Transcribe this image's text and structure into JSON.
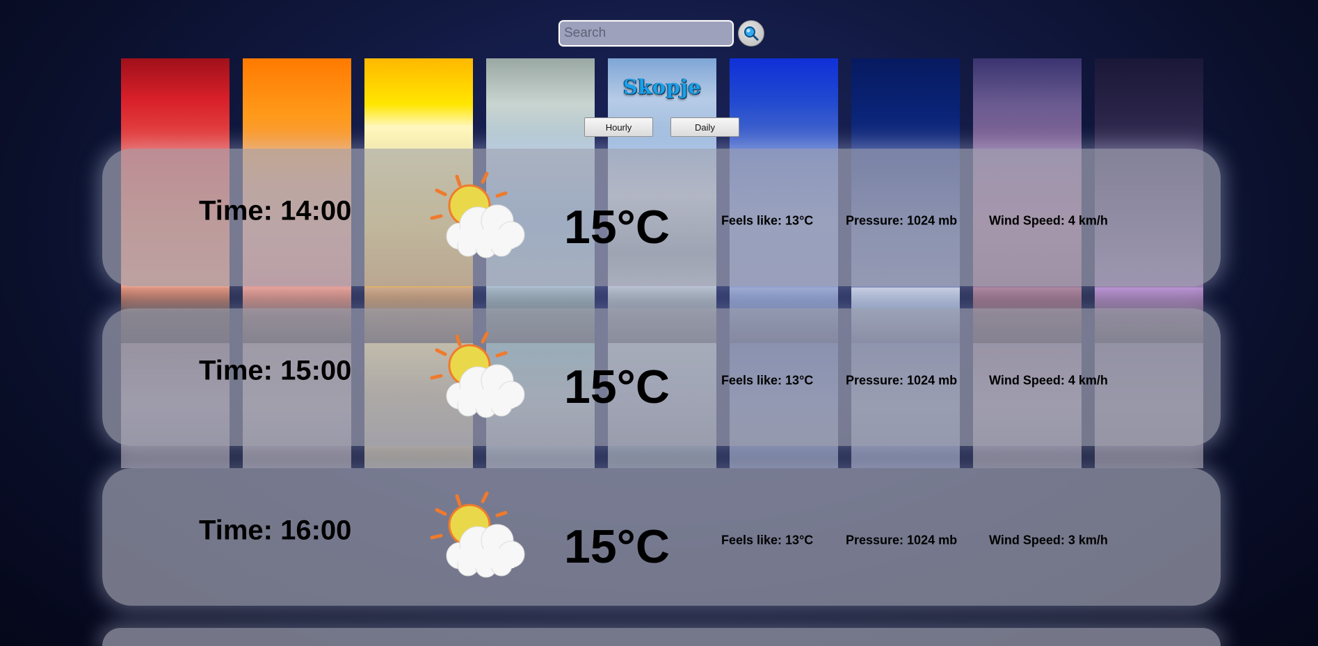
{
  "search": {
    "placeholder": "Search"
  },
  "city": "Skopje",
  "tabs": {
    "hourly": "Hourly",
    "daily": "Daily"
  },
  "icons": {
    "search_button": "magnifier-icon",
    "forecast": "partly-cloudy-icon"
  },
  "colors": {
    "title": "#1aa0e8",
    "sun": "#e9d84a",
    "sun_rays": "#f07a2c",
    "cloud": "#f7f7f7"
  },
  "forecast": [
    {
      "time": "Time: 14:00",
      "temp": "15°C",
      "feels": "Feels like: 13°C",
      "pressure": "Pressure: 1024 mb",
      "wind": "Wind Speed: 4 km/h"
    },
    {
      "time": "Time: 15:00",
      "temp": "15°C",
      "feels": "Feels like: 13°C",
      "pressure": "Pressure: 1024 mb",
      "wind": "Wind Speed: 4 km/h"
    },
    {
      "time": "Time: 16:00",
      "temp": "15°C",
      "feels": "Feels like: 13°C",
      "pressure": "Pressure: 1024 mb",
      "wind": "Wind Speed: 3 km/h"
    }
  ]
}
